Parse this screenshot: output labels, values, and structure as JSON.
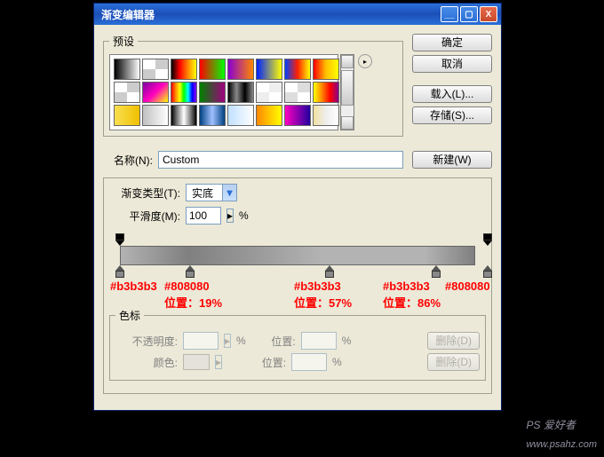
{
  "window": {
    "title": "渐变编辑器",
    "min_icon": "__",
    "max_icon": "▢",
    "close_icon": "X"
  },
  "buttons": {
    "ok": "确定",
    "cancel": "取消",
    "load": "载入(L)...",
    "save": "存储(S)...",
    "new": "新建(W)"
  },
  "presets": {
    "legend": "预设",
    "play_icon": "▸",
    "swatches": [
      "linear-gradient(to right,#000,#fff)",
      "repeating-conic-gradient(#ccc 0 25%, #fff 0 50%)",
      "linear-gradient(to right,#000,#ff0000,#ff8800,#ffff00)",
      "linear-gradient(to right,#ff0000,#00ff00)",
      "linear-gradient(to right,#8a00d0,#ff8800)",
      "linear-gradient(to right,#0020ff,#ffff00)",
      "linear-gradient(to right,#0040ff,#ff2000,#ffff00)",
      "linear-gradient(to right,#ff0000,#ffc000,#ffff00)",
      "repeating-conic-gradient(#ccc 0 25%, #fff 0 50%)",
      "linear-gradient(135deg,#7b00a0,#ff00c0,#ffff00)",
      "linear-gradient(to right,#ff0000,#ff8800,#ffff00,#00ff00,#00ffff,#0000ff,#8800ff)",
      "linear-gradient(to right,#008000,#a00080)",
      "linear-gradient(to right,#000,#888,#000,#888)",
      "repeating-conic-gradient(#eee 0 25%, #fff 0 50%)",
      "repeating-conic-gradient(#ddd 0 25%, #fff 0 50%)",
      "linear-gradient(to right,#ff0,#f80,#f00,#808)",
      "linear-gradient(to right,#f8e050,#f0c000)",
      "linear-gradient(to right,#c0c0c0,#ffffff)",
      "linear-gradient(to right,#000,#888,#fff,#888,#000)",
      "linear-gradient(to right,#004080,#a0c0ff,#004080)",
      "linear-gradient(to right,#c0e0ff,#ffffff)",
      "linear-gradient(to right,#ff8800,#ffff00)",
      "linear-gradient(to right,#ff00c0,#2000a0)",
      "linear-gradient(to right,#f0e0a0,#eee,#fff)"
    ]
  },
  "name": {
    "label": "名称(N):",
    "value": "Custom"
  },
  "type": {
    "label": "渐变类型(T):",
    "value": "实底",
    "arrow": "▾"
  },
  "smooth": {
    "label": "平滑度(M):",
    "value": "100",
    "arrow": "▸",
    "unit": "%"
  },
  "gradient": {
    "css": "linear-gradient(to right,#b3b3b3 0%,#808080 19%,#b3b3b3 57%,#b3b3b3 86%,#808080 100%)",
    "color_stops": [
      {
        "pos": "0%"
      },
      {
        "pos": "19%"
      },
      {
        "pos": "57%"
      },
      {
        "pos": "86%"
      },
      {
        "pos": "100%"
      }
    ],
    "opacity_stops": [
      {
        "pos": "0%"
      },
      {
        "pos": "100%"
      }
    ]
  },
  "annotations": {
    "lbl0": "#b3b3b3",
    "lbl1": "#808080",
    "pos1": "位置：19%",
    "lbl2": "#b3b3b3",
    "pos2": "位置：57%",
    "lbl3": "#b3b3b3",
    "pos3": "位置：86%",
    "lbl4": "#808080"
  },
  "stops": {
    "legend": "色标",
    "opacity_label": "不透明度:",
    "color_label": "颜色:",
    "location_label": "位置:",
    "delete": "删除(D)",
    "unit": "%"
  },
  "watermark": {
    "line1": "PS 爱好者",
    "line2": "www.psahz.com"
  }
}
